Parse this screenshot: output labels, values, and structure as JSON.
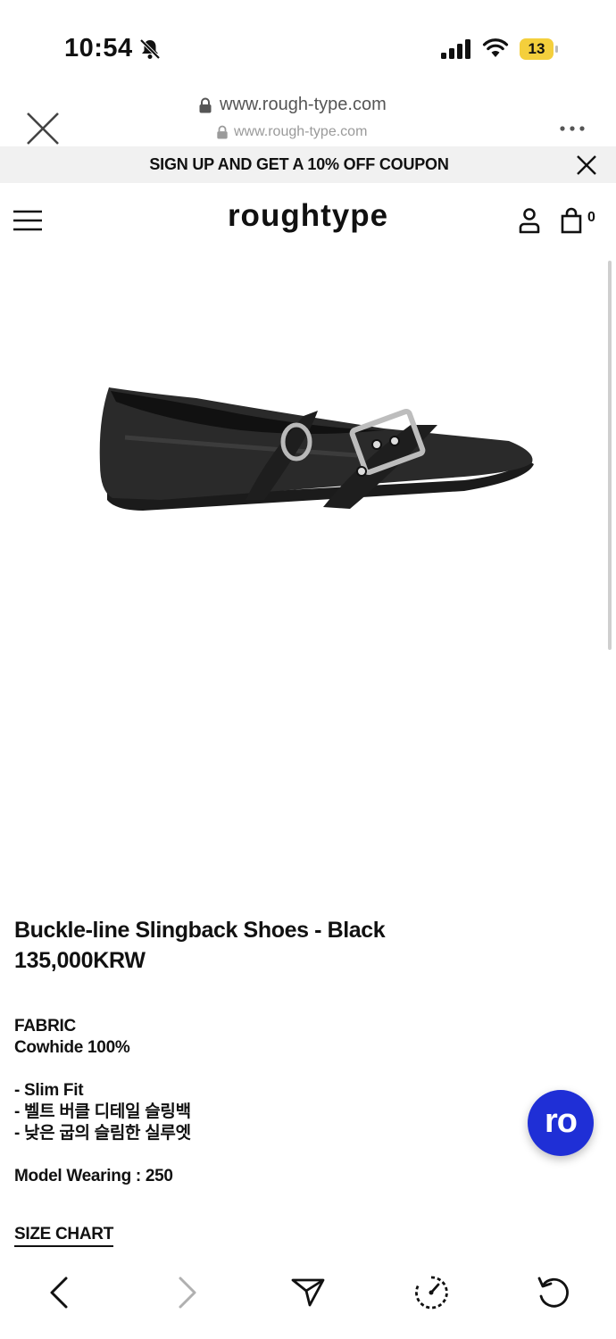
{
  "status_bar": {
    "time": "10:54",
    "battery": "13"
  },
  "browser": {
    "url": "www.rough-type.com",
    "url_secondary": "www.rough-type.com"
  },
  "promo": {
    "text": "SIGN UP AND GET A 10% OFF COUPON"
  },
  "header": {
    "logo": "roughtype",
    "cart_count": "0"
  },
  "product": {
    "name": "Buckle-line Slingback Shoes - Black",
    "price": "135,000KRW",
    "fabric_label": "FABRIC",
    "fabric_value": "Cowhide 100%",
    "features": [
      "- Slim Fit",
      "- 벨트 버클 디테일 슬링백",
      "- 낮은 굽의 슬림한 실루엣"
    ],
    "model_wearing": "Model Wearing : 250",
    "size_chart_label": "SIZE CHART"
  },
  "chat_button": {
    "label": "ro",
    "color": "#1f2fd6"
  },
  "icons": {
    "toolbar": [
      "back-icon",
      "forward-icon",
      "share-icon",
      "speed-icon",
      "reload-icon"
    ]
  }
}
